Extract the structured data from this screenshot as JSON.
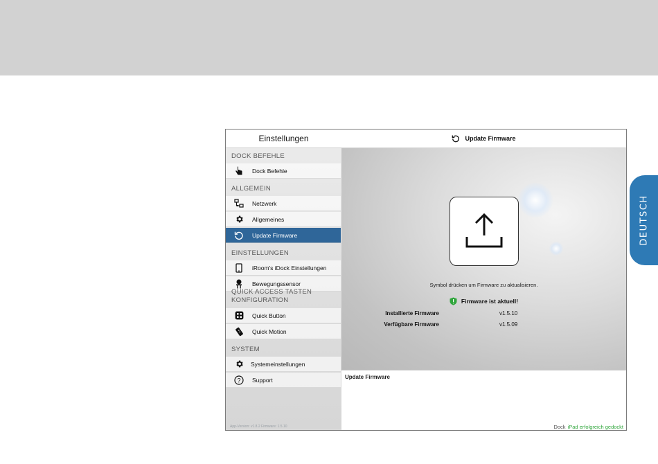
{
  "language_tab": "DEUTSCH",
  "sidebar": {
    "title": "Einstellungen",
    "sections": [
      {
        "title": "DOCK BEFEHLE",
        "items": [
          {
            "label": "Dock Befehle",
            "icon": "hand-pointer-icon"
          }
        ]
      },
      {
        "title": "ALLGEMEIN",
        "items": [
          {
            "label": "Netzwerk",
            "icon": "network-icon"
          },
          {
            "label": "Allgemeines",
            "icon": "gear-icon"
          },
          {
            "label": "Update Firmware",
            "icon": "refresh-icon",
            "active": true
          }
        ]
      },
      {
        "title": "EINSTELLUNGEN",
        "items": [
          {
            "label": "iRoom's iDock Einstellungen",
            "icon": "tablet-icon"
          },
          {
            "label": "Bewegungssensor",
            "icon": "motion-sensor-icon"
          }
        ]
      },
      {
        "title": "QUICK ACCESS TASTEN\nKONFIGURATION",
        "items": [
          {
            "label": "Quick Button",
            "icon": "keypad-icon"
          },
          {
            "label": "Quick Motion",
            "icon": "remote-icon"
          }
        ]
      },
      {
        "title": "SYSTEM",
        "items": [
          {
            "label": "Systemeinstellungen",
            "icon": "gear-icon"
          },
          {
            "label": "Support",
            "icon": "question-circle-icon"
          }
        ]
      }
    ],
    "version": "App-Version: v1.8.2 Firmware: 1.5.10"
  },
  "main": {
    "header_title": "Update Firmware",
    "instruction": "Symbol drücken um Firmware zu aktualisieren.",
    "status": "Firmware ist aktuell!",
    "installed_label": "Installierte Firmware",
    "installed_value": "v1.5.10",
    "available_label": "Verfügbare Firmware",
    "available_value": "v1.5.09"
  },
  "detail": {
    "title": "Update Firmware"
  },
  "status_bar": {
    "dock_label": "Dock",
    "dock_status": "iPad erfolgreich gedockt"
  },
  "colors": {
    "accent": "#2f6699",
    "tab": "#2e7ab5",
    "success": "#31a63d",
    "band": "#d2d2d2"
  }
}
